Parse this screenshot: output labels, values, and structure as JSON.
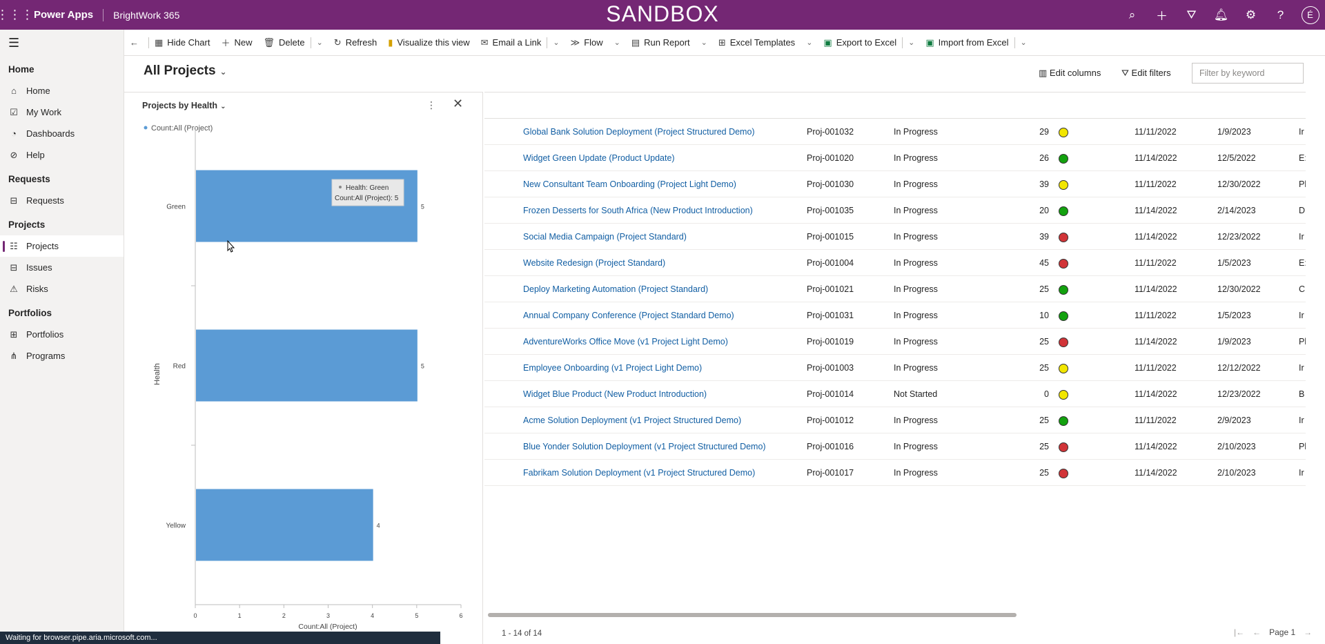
{
  "topbar": {
    "app_name": "Power Apps",
    "environment": "BrightWork 365",
    "banner": "SANDBOX",
    "user_initial": "É"
  },
  "sidebar": {
    "groups": [
      {
        "label": "Home",
        "items": [
          {
            "label": "Home",
            "icon": "home-icon"
          },
          {
            "label": "My Work",
            "icon": "checkbox-icon"
          },
          {
            "label": "Dashboards",
            "icon": "dashboard-icon"
          },
          {
            "label": "Help",
            "icon": "help-icon"
          }
        ]
      },
      {
        "label": "Requests",
        "items": [
          {
            "label": "Requests",
            "icon": "inbox-icon"
          }
        ]
      },
      {
        "label": "Projects",
        "items": [
          {
            "label": "Projects",
            "icon": "projects-icon",
            "active": true
          },
          {
            "label": "Issues",
            "icon": "issues-icon"
          },
          {
            "label": "Risks",
            "icon": "warning-icon"
          }
        ]
      },
      {
        "label": "Portfolios",
        "items": [
          {
            "label": "Portfolios",
            "icon": "portfolio-icon"
          },
          {
            "label": "Programs",
            "icon": "programs-icon"
          }
        ]
      }
    ]
  },
  "commandbar": {
    "hide_chart": "Hide Chart",
    "new": "New",
    "delete": "Delete",
    "refresh": "Refresh",
    "visualize": "Visualize this view",
    "email_link": "Email a Link",
    "flow": "Flow",
    "run_report": "Run Report",
    "excel_templates": "Excel Templates",
    "export_excel": "Export to Excel",
    "import_excel": "Import from Excel"
  },
  "view": {
    "title": "All Projects",
    "edit_columns": "Edit columns",
    "edit_filters": "Edit filters",
    "filter_placeholder": "Filter by keyword"
  },
  "chart_panel": {
    "title": "Projects by Health"
  },
  "chart_data": {
    "type": "bar",
    "orientation": "horizontal",
    "legend": [
      "Count:All (Project)"
    ],
    "categories": [
      "Green",
      "Red",
      "Yellow"
    ],
    "values": [
      5,
      5,
      4
    ],
    "xlabel": "Count:All (Project)",
    "ylabel": "Health",
    "xlim": [
      0,
      6
    ],
    "xticks": [
      "0",
      "1",
      "2",
      "3",
      "4",
      "5",
      "6"
    ],
    "tooltip": {
      "line1": "Health: Green",
      "line2": "Count:All (Project): 5"
    },
    "bar_color": "#5b9bd5"
  },
  "grid": {
    "rows": [
      {
        "name": "Global Bank Solution Deployment (Project Structured Demo)",
        "id": "Proj-001032",
        "status": "In Progress",
        "duration": "29",
        "health": "yellow",
        "start": "11/11/2022",
        "finish": "1/9/2023",
        "extra": "Ir"
      },
      {
        "name": "Widget Green Update (Product Update)",
        "id": "Proj-001020",
        "status": "In Progress",
        "duration": "26",
        "health": "green",
        "start": "11/14/2022",
        "finish": "12/5/2022",
        "extra": "E:"
      },
      {
        "name": "New Consultant Team Onboarding (Project Light Demo)",
        "id": "Proj-001030",
        "status": "In Progress",
        "duration": "39",
        "health": "yellow",
        "start": "11/11/2022",
        "finish": "12/30/2022",
        "extra": "Pl"
      },
      {
        "name": "Frozen Desserts for South Africa (New Product Introduction)",
        "id": "Proj-001035",
        "status": "In Progress",
        "duration": "20",
        "health": "green",
        "start": "11/14/2022",
        "finish": "2/14/2023",
        "extra": "D"
      },
      {
        "name": "Social Media Campaign (Project Standard)",
        "id": "Proj-001015",
        "status": "In Progress",
        "duration": "39",
        "health": "red",
        "start": "11/14/2022",
        "finish": "12/23/2022",
        "extra": "Ir"
      },
      {
        "name": "Website Redesign (Project Standard)",
        "id": "Proj-001004",
        "status": "In Progress",
        "duration": "45",
        "health": "red",
        "start": "11/11/2022",
        "finish": "1/5/2023",
        "extra": "E:"
      },
      {
        "name": "Deploy Marketing Automation (Project Standard)",
        "id": "Proj-001021",
        "status": "In Progress",
        "duration": "25",
        "health": "green",
        "start": "11/14/2022",
        "finish": "12/30/2022",
        "extra": "C"
      },
      {
        "name": "Annual Company Conference (Project Standard Demo)",
        "id": "Proj-001031",
        "status": "In Progress",
        "duration": "10",
        "health": "green",
        "start": "11/11/2022",
        "finish": "1/5/2023",
        "extra": "Ir"
      },
      {
        "name": "AdventureWorks Office Move (v1 Project Light Demo)",
        "id": "Proj-001019",
        "status": "In Progress",
        "duration": "25",
        "health": "red",
        "start": "11/14/2022",
        "finish": "1/9/2023",
        "extra": "Pl"
      },
      {
        "name": "Employee Onboarding (v1 Project Light Demo)",
        "id": "Proj-001003",
        "status": "In Progress",
        "duration": "25",
        "health": "yellow",
        "start": "11/11/2022",
        "finish": "12/12/2022",
        "extra": "Ir"
      },
      {
        "name": "Widget Blue Product (New Product Introduction)",
        "id": "Proj-001014",
        "status": "Not Started",
        "duration": "0",
        "health": "yellow",
        "start": "11/14/2022",
        "finish": "12/23/2022",
        "extra": "B"
      },
      {
        "name": "Acme Solution Deployment (v1 Project Structured Demo)",
        "id": "Proj-001012",
        "status": "In Progress",
        "duration": "25",
        "health": "green",
        "start": "11/11/2022",
        "finish": "2/9/2023",
        "extra": "Ir"
      },
      {
        "name": "Blue Yonder Solution Deployment (v1 Project Structured Demo)",
        "id": "Proj-001016",
        "status": "In Progress",
        "duration": "25",
        "health": "red",
        "start": "11/14/2022",
        "finish": "2/10/2023",
        "extra": "Pl"
      },
      {
        "name": "Fabrikam Solution Deployment (v1 Project Structured Demo)",
        "id": "Proj-001017",
        "status": "In Progress",
        "duration": "25",
        "health": "red",
        "start": "11/14/2022",
        "finish": "2/10/2023",
        "extra": "Ir"
      }
    ],
    "footer": "1 - 14 of 14",
    "page_label": "Page 1"
  },
  "health_colors": {
    "green": "#13a10e",
    "yellow": "#f2e600",
    "red": "#d13438"
  },
  "statusbar": "Waiting for browser.pipe.aria.microsoft.com..."
}
